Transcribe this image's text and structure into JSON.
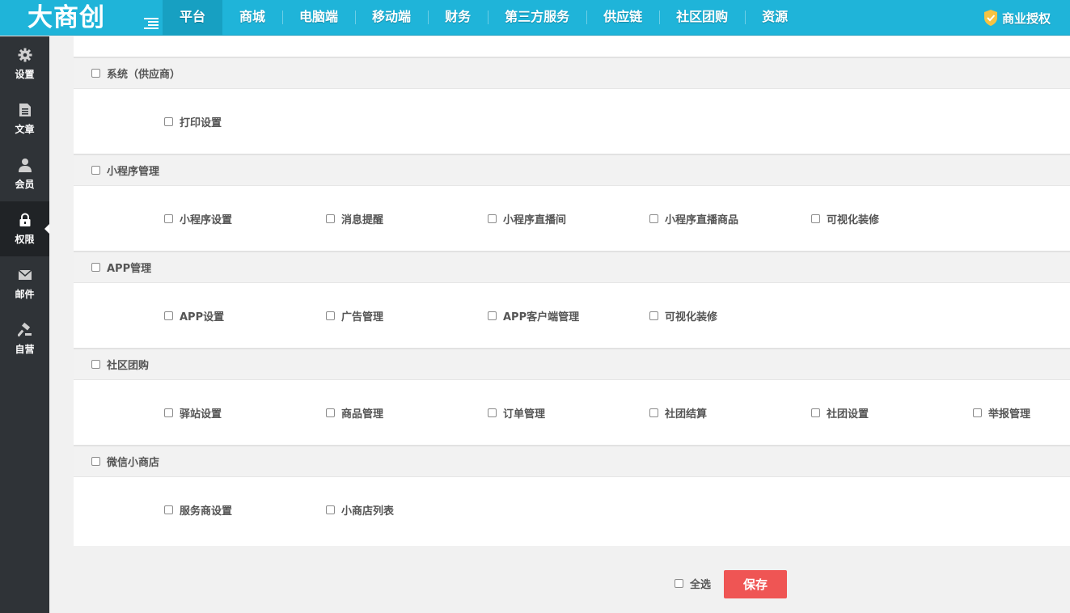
{
  "app": {
    "logo_text": "大商创",
    "license_label": "商业授权"
  },
  "top_nav": [
    {
      "label": "平台",
      "active": true
    },
    {
      "label": "商城"
    },
    {
      "label": "电脑端"
    },
    {
      "label": "移动端"
    },
    {
      "label": "财务"
    },
    {
      "label": "第三方服务"
    },
    {
      "label": "供应链"
    },
    {
      "label": "社区团购"
    },
    {
      "label": "资源"
    }
  ],
  "sidebar": [
    {
      "label": "设置",
      "icon": "gear-icon"
    },
    {
      "label": "文章",
      "icon": "document-icon"
    },
    {
      "label": "会员",
      "icon": "user-icon"
    },
    {
      "label": "权限",
      "icon": "lock-icon",
      "active": true
    },
    {
      "label": "邮件",
      "icon": "envelope-icon"
    },
    {
      "label": "自营",
      "icon": "hammer-icon"
    }
  ],
  "sections": [
    {
      "title": "系统（供应商）",
      "items": [
        "打印设置"
      ]
    },
    {
      "title": "小程序管理",
      "items": [
        "小程序设置",
        "消息提醒",
        "小程序直播间",
        "小程序直播商品",
        "可视化装修"
      ]
    },
    {
      "title": "APP管理",
      "items": [
        "APP设置",
        "广告管理",
        "APP客户端管理",
        "可视化装修"
      ]
    },
    {
      "title": "社区团购",
      "items": [
        "驿站设置",
        "商品管理",
        "订单管理",
        "社团结算",
        "社团设置",
        "举报管理"
      ]
    },
    {
      "title": "微信小商店",
      "items": [
        "服务商设置",
        "小商店列表"
      ]
    }
  ],
  "footer": {
    "select_all_label": "全选",
    "save_label": "保存"
  },
  "colors": {
    "topbar": "#1fb4d9",
    "sidebar": "#2f3337",
    "save_button": "#ef5554"
  }
}
